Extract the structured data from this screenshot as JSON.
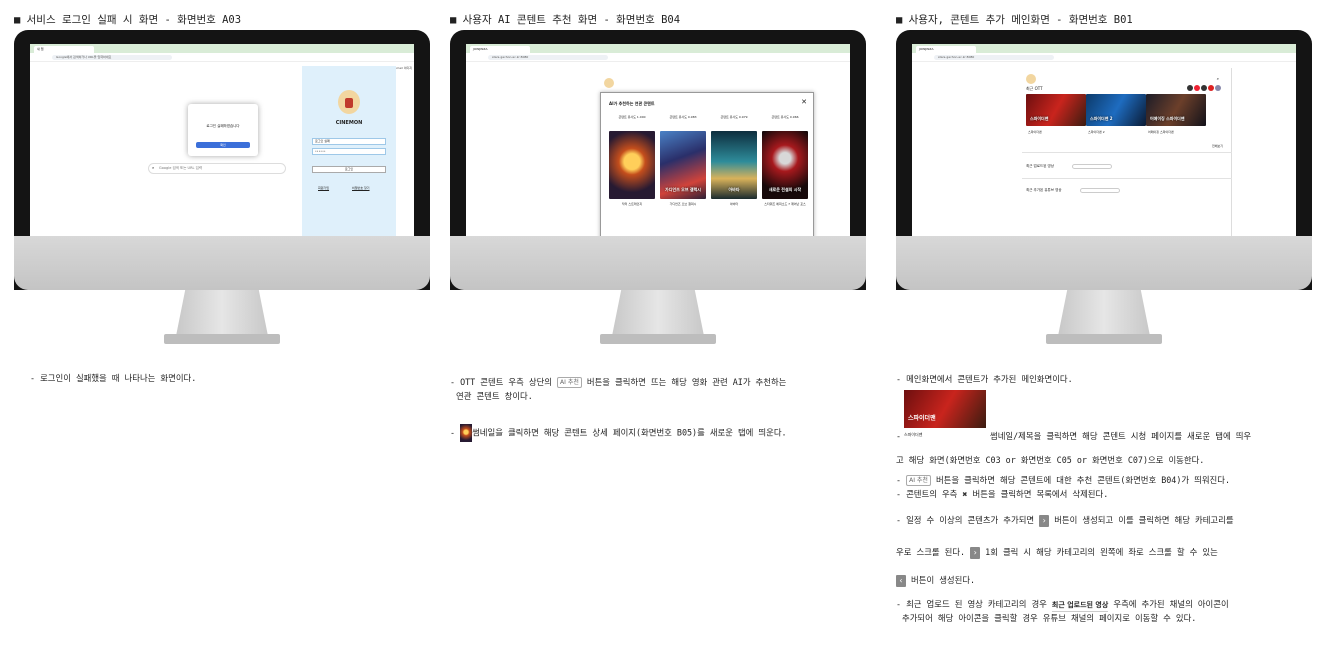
{
  "panels": {
    "a03": {
      "title": "■ 서비스 로그인 실패 시 화면 - 화면번호 A03",
      "screen": {
        "tab_label": "새 탭",
        "address": "Google에서 검색하거나 URL을 입력하세요",
        "search_placeholder": "Google 검색 또는 URL 입력",
        "alert_message": "로그인 실패하였습니다",
        "alert_button": "확인",
        "login_title": "CINEMON",
        "id_value": "로그인 실패",
        "pw_value": "••••••",
        "login_button": "로그인",
        "link_signup": "회원가입",
        "link_find": "비밀번호 찾기",
        "gmail": "Gmail 이미지"
      },
      "desc": "- 로그인이 실패했을 때 나타나는 화면이다."
    },
    "b04": {
      "title": "■ 사용자 AI 콘텐트 추천 화면 - 화면번호 B04",
      "screen": {
        "tab_label": "JOINJINZA",
        "address": "stars.gachon.ac.kr:8080",
        "modal_title": "AI가 추천하는 연관 콘텐트",
        "close": "✕",
        "recs": [
          {
            "cap": "콘텐트 유사도 1.000",
            "poster_text": "",
            "name": "닥터 스트레인지"
          },
          {
            "cap": "콘텐트 유사도 0.983",
            "poster_text": "가디언즈 오브 갤럭시",
            "name": "가디언즈 오브 갤럭시"
          },
          {
            "cap": "콘텐트 유사도 0.979",
            "poster_text": "아바타",
            "name": "아바타"
          },
          {
            "cap": "콘텐트 유사도 0.966",
            "poster_text": "새로운 전설의 시작",
            "name": "스타워즈 에피소드 7 깨어난 포스"
          }
        ]
      },
      "desc": {
        "line1_a": "- OTT 콘텐트 우측 상단의 ",
        "badge": "AI 추천",
        "line1_b": " 버튼을 클릭하면 뜨는 해당 영화 관련 AI가 추천하는",
        "line2": "연관 콘텐트 창이다.",
        "line3_a": "- ",
        "line3_b": "썸네일을 클릭하면 해당 콘텐트 상세 페이지(화면번호 B05)를 새로운 탭에 띄운다."
      }
    },
    "b01": {
      "title": "■ 사용자, 콘텐트 추가 메인화면 - 화면번호 B01",
      "screen": {
        "tab_label": "JOINJINZA",
        "address": "stars.gachon.ac.kr:8080",
        "section_ott": "최근 OTT",
        "thumbs": [
          {
            "label": "스파이더맨",
            "cap": "스파이더맨"
          },
          {
            "label": "스파이더맨 2",
            "cap": "스파이더맨 2"
          },
          {
            "label": "어메이징 스파이더맨",
            "cap": "어메이징 스파이더맨"
          }
        ],
        "more": "전체보기",
        "section_uploaded": "최근 업로드된 영상",
        "section_youtube": "최근 추가된 유튜브 영상"
      },
      "desc": {
        "l1": "- 메인화면에서 콘텐트가 추가된 메인화면이다.",
        "thumb_label": "스파이더맨",
        "thumb_text": "스파이더맨",
        "l2": "썸네일/제목을 클릭하면 해당 콘텐트 시청 페이지를 새로운 탭에 띄우",
        "l3": "고 해당 화면(화면번호 C03 or 화면번호 C05 or 화면번호 C07)으로 이동한다.",
        "l4_a": "- ",
        "badge": "AI 추천",
        "l4_b": " 버튼을 클릭하면 해당 콘텐트에 대한 추천 콘텐트(화면번호 B04)가 띄워진다.",
        "l5_a": "- 콘텐트의 우측 ",
        "x_mark": "✖",
        "l5_b": " 버튼을 클릭하면 목록에서 삭제된다.",
        "l6_a": "- 일정 수 이상의 콘텐츠가 추가되면 ",
        "chev_right": "›",
        "l6_b": " 버튼이 생성되고 이를 클릭하면 해당 카테고리를",
        "l7_a": "우로 스크롤 된다. ",
        "l7_b": " 1회 클릭 시 해당 카테고리의 왼쪽에 좌로 스크롤 할 수 있는",
        "chev_left": "‹",
        "l8": " 버튼이 생성된다.",
        "l9_a": "- 최근 업로드 된 영상 카테고리의 경우 ",
        "bold": "최근 업로드된 영상",
        "l9_b": " 우측에 추가된 채널의 아이콘이",
        "l10": "추가되어 해당 아이콘을 클릭할 경우 유튜브 채널의 페이지로 이동할 수 있다."
      }
    }
  }
}
